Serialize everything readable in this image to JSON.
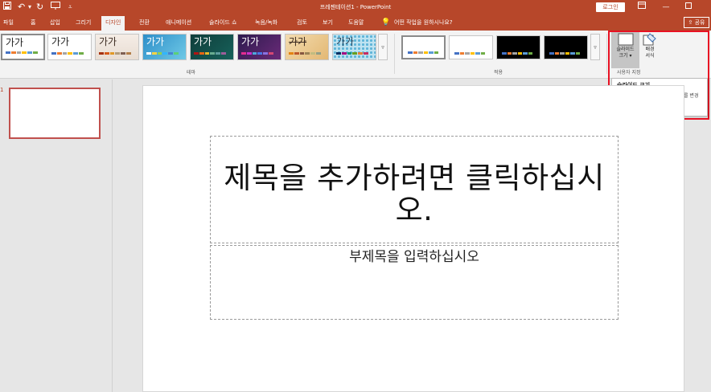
{
  "titlebar": {
    "title": "프레젠테이션1 - PowerPoint",
    "login": "로그인",
    "quick_access": {
      "save_icon": "save-icon",
      "undo_icon": "undo-icon",
      "redo_icon": "redo-icon",
      "present_icon": "present-icon",
      "customize_icon": "customize-icon"
    },
    "window_icons": [
      "ribbon-display-icon",
      "minimize-icon",
      "maximize-icon"
    ]
  },
  "tabs": {
    "file": "파일",
    "home": "홈",
    "insert": "삽입",
    "draw": "그리기",
    "design": "디자인",
    "transitions": "전환",
    "animations": "애니메이션",
    "slideshow": "슬라이드 쇼",
    "record": "녹음/녹화",
    "review": "검토",
    "view": "보기",
    "help": "도움말",
    "tell_me": "어떤 작업을 원하시나요?",
    "share": "공유"
  },
  "ribbon": {
    "themes": {
      "sample_text": "가가",
      "group_label": "테마"
    },
    "variants": {
      "group_label": "적용"
    },
    "customize": {
      "slide_size_line1": "슬라이드",
      "slide_size_line2": "크기 ▾",
      "format_bg_line1": "배경",
      "format_bg_line2": "서식",
      "group_label": "사용자 지정"
    }
  },
  "tooltip": {
    "title": "슬라이드 크기",
    "description": "이 프레젠테이션의 슬라이드 크기를 변경합니다."
  },
  "thumbnails": {
    "slide_number": "1"
  },
  "slide": {
    "title_placeholder": "제목을 추가하려면 클릭하십시오.",
    "subtitle_placeholder": "부제목을 입력하십시오"
  },
  "colors": {
    "accent": "#b7472a",
    "highlight": "#e81123",
    "selected_thumb": "#c0504d"
  }
}
